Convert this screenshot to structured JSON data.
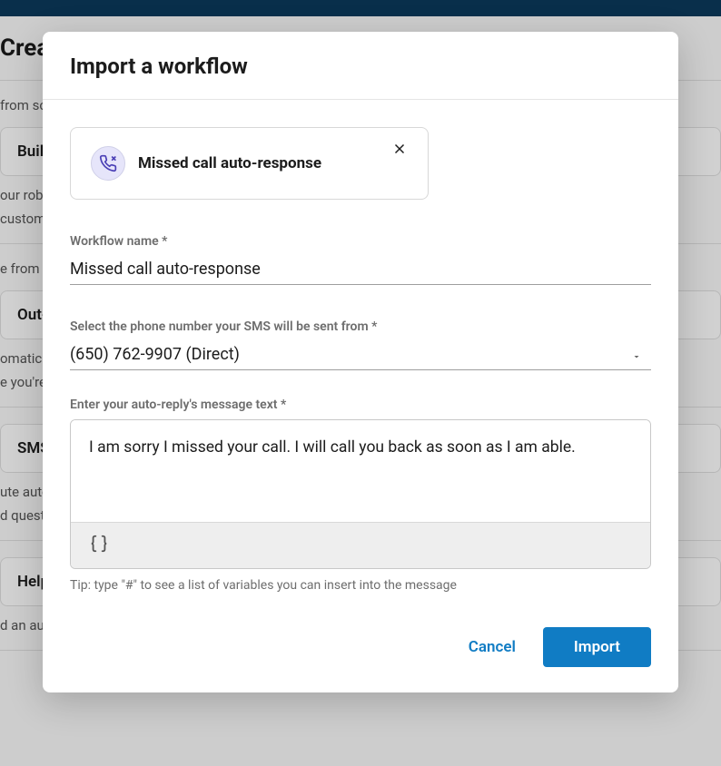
{
  "background": {
    "page_title": "Create",
    "section1_label": "from scratch",
    "card1_title": "Build",
    "card1_desc_l1": "our robust",
    "card1_desc_l2": "customer",
    "section2_label": "e from template",
    "card2_title": "Out-",
    "card2_desc_l1": "omatically",
    "card2_desc_l2": "e you're",
    "card3_title": "SMS",
    "card3_desc_l1": "ute auto-",
    "card3_desc_l2": "d questions",
    "card4_title": "Help request auto-response",
    "card4_desc": "d an automated response when someone"
  },
  "modal": {
    "title": "Import a workflow",
    "workflow_card_title": "Missed call auto-response",
    "labels": {
      "name": "Workflow name *",
      "phone": "Select the phone number your SMS will be sent from *",
      "message": "Enter your auto-reply's message text *"
    },
    "values": {
      "name": "Missed call auto-response",
      "phone": "(650) 762-9907 (Direct)",
      "message": "I am sorry I missed your call. I will call you back as soon as I am able."
    },
    "tip": "Tip: type \"#\" to see a list of variables you can insert into the message",
    "buttons": {
      "cancel": "Cancel",
      "import": "Import"
    }
  }
}
